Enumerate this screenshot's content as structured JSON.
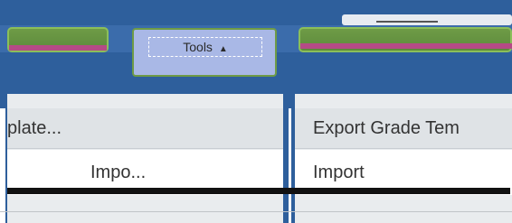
{
  "toolbar": {
    "tools_label": "Tools",
    "tools_caret": "▲"
  },
  "menu_left": {
    "header": "plate...",
    "item": "Impo..."
  },
  "menu_right": {
    "header": "Export Grade Tem",
    "item": "Import"
  },
  "colors": {
    "toolbar_blue": "#2e5f9c",
    "button_green": "#6e9b46",
    "accent_pink": "#b54a86",
    "tools_highlight": "#a9b8e6"
  },
  "icons": {
    "tools_caret": "caret-up-icon"
  }
}
